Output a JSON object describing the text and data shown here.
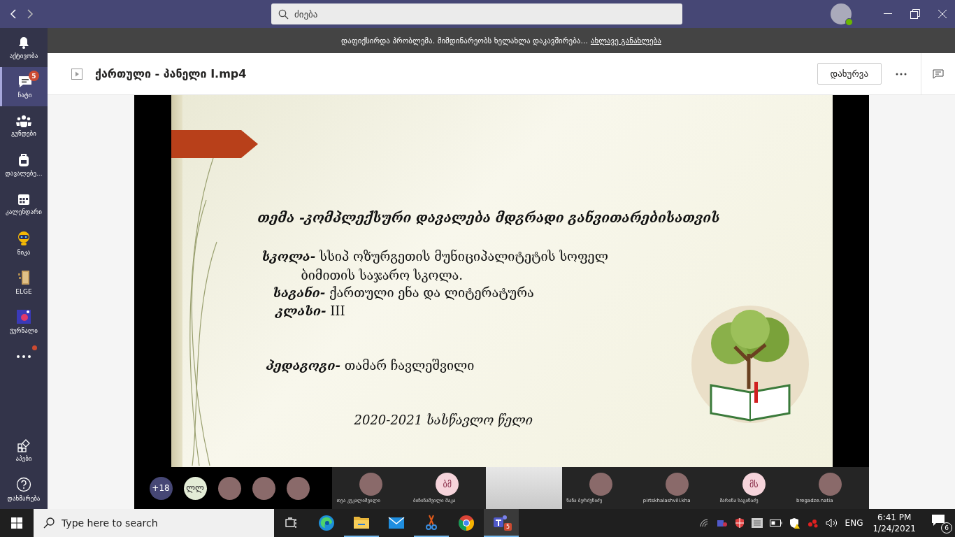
{
  "titlebar": {
    "search": {
      "placeholder": "ძიება"
    }
  },
  "sidebar": {
    "items": [
      {
        "label": "აქტივობა",
        "selected": false
      },
      {
        "label": "ჩატი",
        "selected": true,
        "badge": "5"
      },
      {
        "label": "გუნდები",
        "selected": false
      },
      {
        "label": "დავალებე...",
        "selected": false
      },
      {
        "label": "კალენდარი",
        "selected": false
      },
      {
        "label": "ნიკა",
        "selected": false
      },
      {
        "label": "ELGE",
        "selected": false
      },
      {
        "label": "ჟურნალი",
        "selected": false
      }
    ],
    "more": {
      "dot": true
    },
    "bottom": [
      {
        "label": "აპები"
      },
      {
        "label": "დახმარება"
      }
    ]
  },
  "banner": {
    "message": "დაფიქსირდა პრობლემა. მიმდინარეობს ხელახლა დაკავშირება...",
    "link": "ახლავე განახლება"
  },
  "header": {
    "title": "ქართული - პანელი I.mp4",
    "close_button": "დახურვა"
  },
  "slide": {
    "heading": "თემა -კომპლექსური დავალება მდგრადი განვითარებისათვის",
    "fields": [
      {
        "label": "სკოლა-",
        "text": "სსიპ ოზურგეთის მუნიციპალიტეტის სოფელ",
        "continuation": "ბიმითის საჯარო სკოლა."
      },
      {
        "label": "საგანი-",
        "text": "ქართული ენა და ლიტერატურა"
      },
      {
        "label": "კლასი-",
        "text": "III"
      },
      {
        "label": "პედაგოგი-",
        "text": "თამარ ჩავლეშვილი"
      }
    ],
    "footer": "2020-2021 სასწავლო წელი"
  },
  "participants": {
    "overflow": "+18",
    "circles": [
      {
        "kind": "initials",
        "initials": "ლლ"
      },
      {
        "kind": "photo"
      },
      {
        "kind": "photo"
      },
      {
        "kind": "photo"
      }
    ],
    "tiles": [
      {
        "kind": "photo",
        "name": "თეა კუკალიშვილი"
      },
      {
        "kind": "initials",
        "initials": "ბმ",
        "name": "ბიჩინაშვილი მაკა"
      },
      {
        "kind": "video"
      },
      {
        "kind": "photo",
        "name": "ნანა ბერძენიძე"
      },
      {
        "kind": "photo",
        "name": "pirtskhalashvili.kha"
      },
      {
        "kind": "initials",
        "initials": "მს",
        "name": "მარინა საგინაძე"
      },
      {
        "kind": "photo",
        "name": "bregadze.natia"
      }
    ]
  },
  "taskbar": {
    "search": {
      "placeholder": "Type here to search"
    },
    "apps": [
      {
        "active": false
      },
      {
        "active": false
      },
      {
        "active": true
      },
      {
        "active": false
      },
      {
        "active": true
      },
      {
        "active": false
      },
      {
        "active": true,
        "badge": "5"
      }
    ],
    "language": "ENG",
    "time": "6:41 PM",
    "date": "1/24/2021",
    "notifications": "6"
  }
}
